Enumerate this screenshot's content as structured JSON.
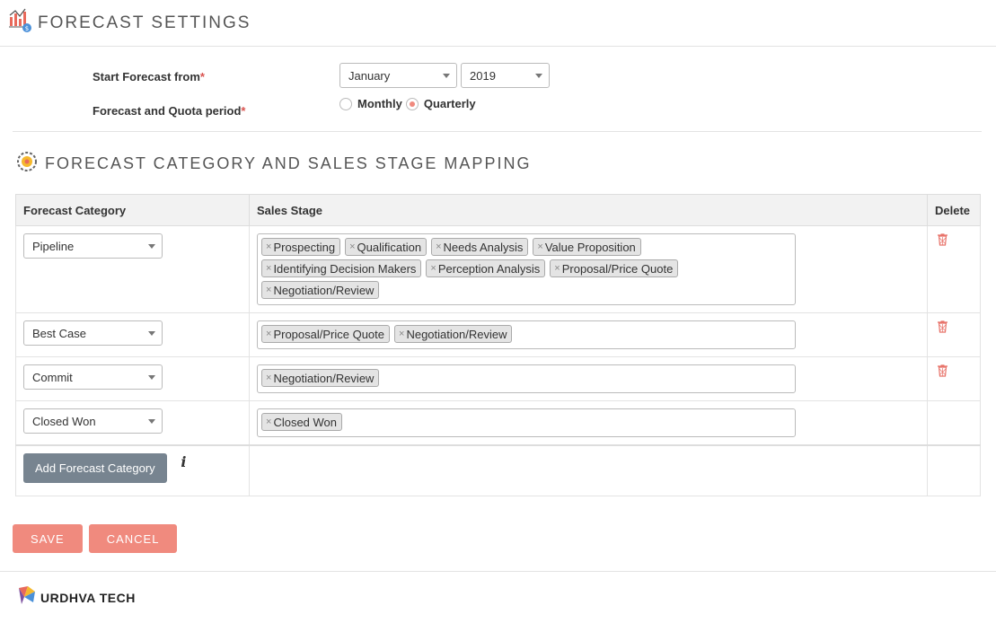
{
  "header": {
    "title": "FORECAST SETTINGS"
  },
  "settings": {
    "start_label": "Start Forecast from",
    "required_mark": "*",
    "month_value": "January",
    "year_value": "2019",
    "period_label": "Forecast and Quota period",
    "period_options": [
      "Monthly",
      "Quarterly"
    ],
    "period_selected": "Quarterly"
  },
  "mapping": {
    "title": "FORECAST CATEGORY AND SALES STAGE MAPPING",
    "columns": [
      "Forecast Category",
      "Sales Stage",
      "Delete"
    ],
    "rows": [
      {
        "category": "Pipeline",
        "stages": [
          "Prospecting",
          "Qualification",
          "Needs Analysis",
          "Value Proposition",
          "Identifying Decision Makers",
          "Perception Analysis",
          "Proposal/Price Quote",
          "Negotiation/Review"
        ],
        "deletable": true
      },
      {
        "category": "Best Case",
        "stages": [
          "Proposal/Price Quote",
          "Negotiation/Review"
        ],
        "deletable": true
      },
      {
        "category": "Commit",
        "stages": [
          "Negotiation/Review"
        ],
        "deletable": true
      },
      {
        "category": "Closed Won",
        "stages": [
          "Closed Won"
        ],
        "deletable": false
      }
    ],
    "add_button": "Add Forecast Category",
    "info_glyph": "i"
  },
  "actions": {
    "save": "SAVE",
    "cancel": "CANCEL"
  },
  "footer": {
    "brand": "URDHVA TECH"
  },
  "colors": {
    "accent": "#f08a7e",
    "add_button": "#778490",
    "trash": "#e8736a"
  }
}
